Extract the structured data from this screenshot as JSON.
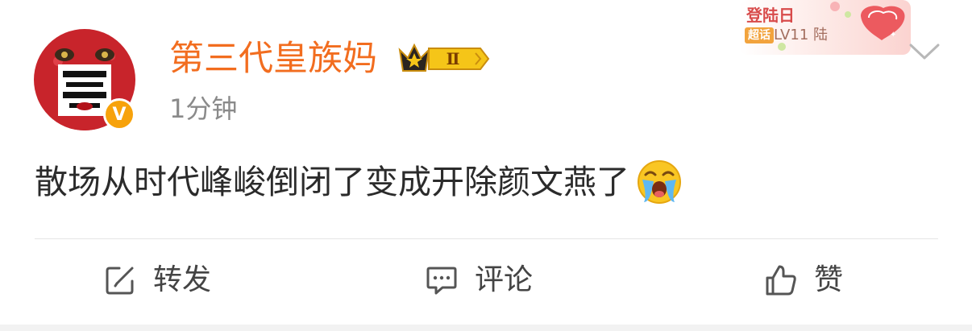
{
  "post": {
    "username": "第三代皇族妈",
    "badge_level": "Ⅱ",
    "verified_mark": "V",
    "timestamp": "1分钟",
    "text": "散场从时代峰峻倒闭了变成开除颜文燕了"
  },
  "checkin_tag": {
    "title": "登陆日",
    "supertopic_label": "超话",
    "level": "LV11 陆"
  },
  "actions": {
    "repost": "转发",
    "comment": "评论",
    "like": "赞"
  },
  "icons": {
    "repost": "share-edit-icon",
    "comment": "comment-bubble-icon",
    "like": "thumbs-up-icon",
    "menu": "chevron-down-icon",
    "emoji": "crying-face-emoji",
    "crown": "crown-icon"
  },
  "colors": {
    "username": "#f26d1f",
    "timestamp": "#8a8a8a",
    "text": "#2b2b2b",
    "verified": "#f7a20b",
    "badge_gold": "#f5c518"
  }
}
